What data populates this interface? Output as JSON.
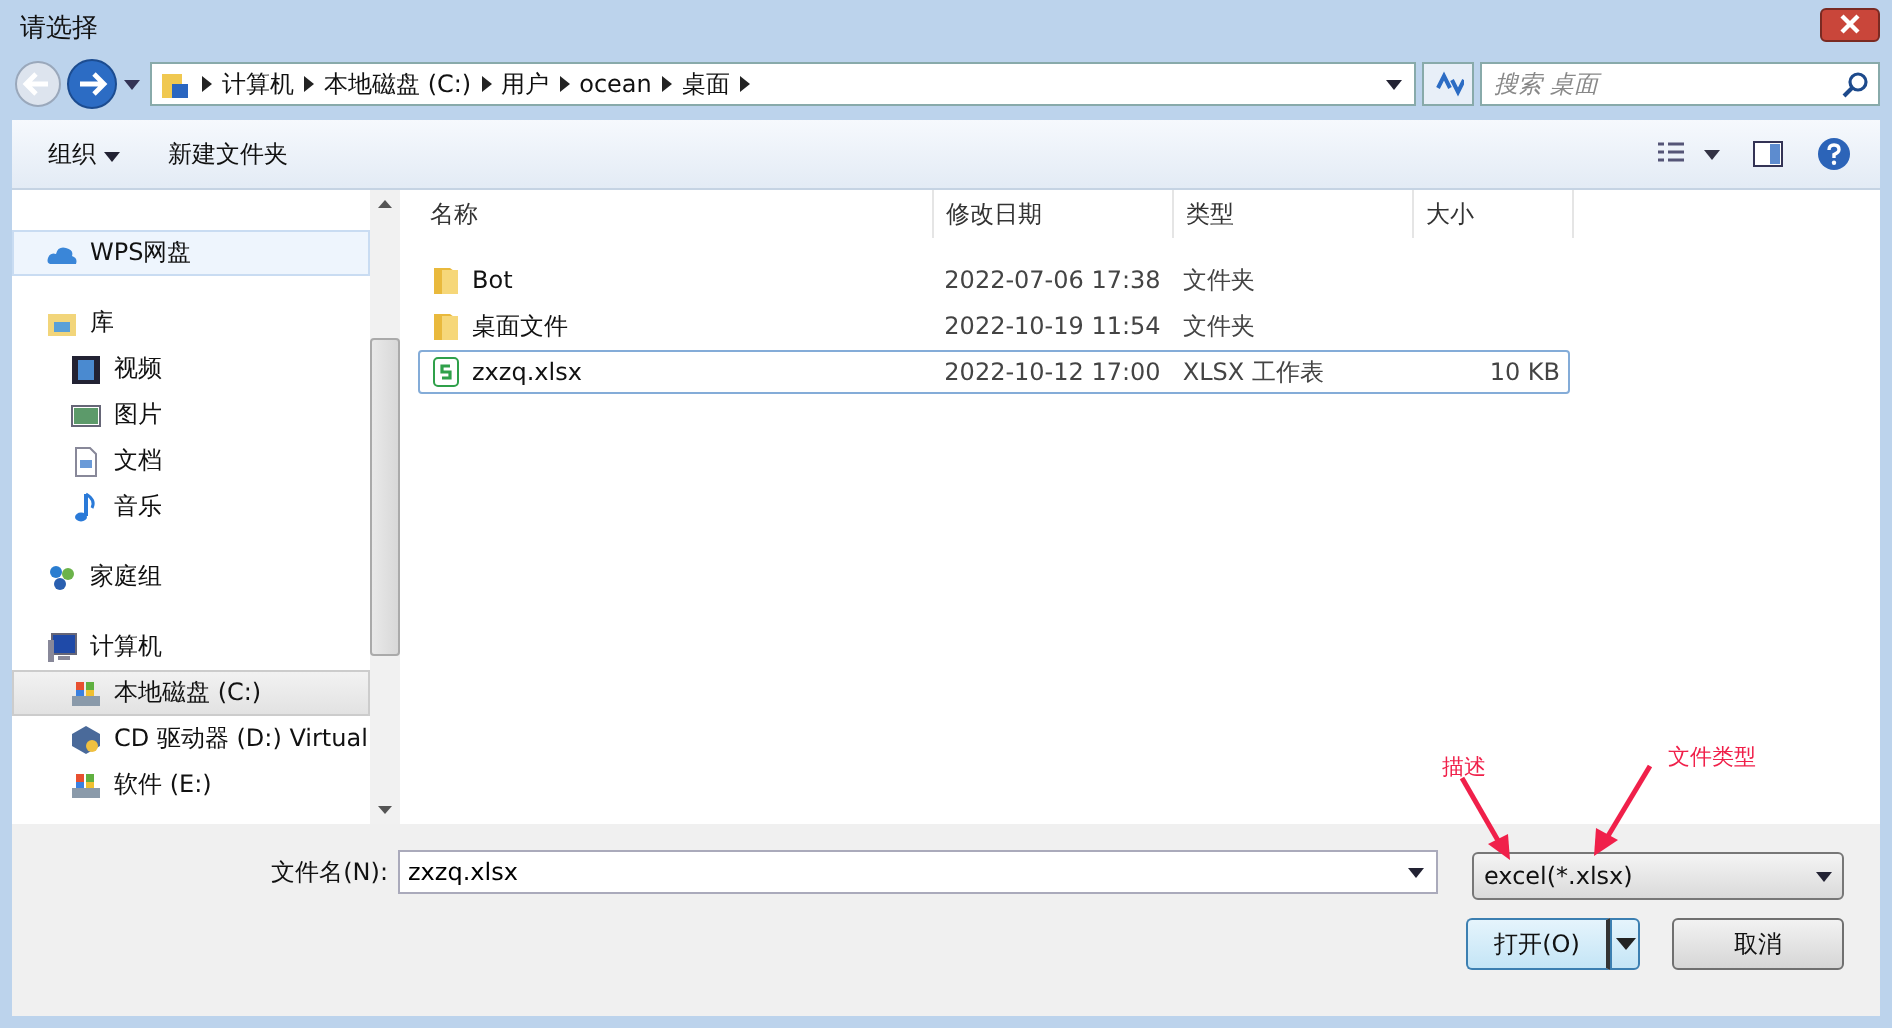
{
  "window": {
    "title": "请选择"
  },
  "address": {
    "crumbs": [
      "计算机",
      "本地磁盘 (C:)",
      "用户",
      "ocean",
      "桌面"
    ]
  },
  "search": {
    "placeholder": "搜索 桌面"
  },
  "toolbar": {
    "organize": "组织",
    "new_folder": "新建文件夹"
  },
  "sidebar": {
    "groups": [
      {
        "label": "WPS网盘",
        "kind": "cloud",
        "selected": false,
        "hover": true
      },
      {
        "label": "库",
        "kind": "library",
        "selected": false,
        "hover": false,
        "children": [
          {
            "label": "视频",
            "kind": "video",
            "selected": false
          },
          {
            "label": "图片",
            "kind": "picture",
            "selected": false
          },
          {
            "label": "文档",
            "kind": "document",
            "selected": false
          },
          {
            "label": "音乐",
            "kind": "music",
            "selected": false
          }
        ]
      },
      {
        "label": "家庭组",
        "kind": "homegroup",
        "selected": false,
        "hover": false
      },
      {
        "label": "计算机",
        "kind": "computer",
        "selected": false,
        "hover": false,
        "children": [
          {
            "label": "本地磁盘 (C:)",
            "kind": "disk",
            "selected": true
          },
          {
            "label": "CD 驱动器 (D:) Virtual",
            "kind": "cd",
            "selected": false
          },
          {
            "label": "软件 (E:)",
            "kind": "disk",
            "selected": false
          }
        ]
      }
    ]
  },
  "table": {
    "columns": [
      "名称",
      "修改日期",
      "类型",
      "大小"
    ],
    "rows": [
      {
        "name": "Bot",
        "modified": "2022-07-06 17:38",
        "type": "文件夹",
        "size": "",
        "kind": "folder",
        "selected": false
      },
      {
        "name": "桌面文件",
        "modified": "2022-10-19 11:54",
        "type": "文件夹",
        "size": "",
        "kind": "folder",
        "selected": false
      },
      {
        "name": "zxzq.xlsx",
        "modified": "2022-10-12 17:00",
        "type": "XLSX 工作表",
        "size": "10 KB",
        "kind": "sheet",
        "selected": true
      }
    ]
  },
  "filename": {
    "label": "文件名(N):",
    "value": "zxzq.xlsx"
  },
  "filetype": {
    "value": "excel(*.xlsx)"
  },
  "buttons": {
    "open": "打开(O)",
    "cancel": "取消"
  },
  "annotations": [
    "描述",
    "文件类型"
  ]
}
